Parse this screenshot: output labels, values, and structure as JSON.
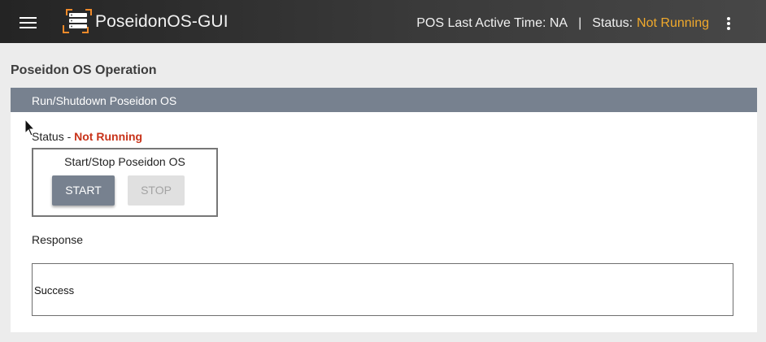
{
  "header": {
    "app_title": "PoseidonOS-GUI",
    "last_active_label": "POS Last Active Time: NA",
    "separator": "|",
    "status_label": "Status:",
    "status_value": "Not Running",
    "status_color": "#f0a92c",
    "logo_icon": "server-stack-icon",
    "menu_icon": "hamburger-menu-icon",
    "more_icon": "kebab-menu-icon"
  },
  "page": {
    "title": "Poseidon OS Operation"
  },
  "panel": {
    "header": "Run/Shutdown Poseidon OS",
    "status_prefix": "Status - ",
    "status_value": "Not Running",
    "control_title": "Start/Stop Poseidon OS",
    "start_label": "START",
    "stop_label": "STOP",
    "response_label": "Response",
    "response_value": "Success"
  }
}
